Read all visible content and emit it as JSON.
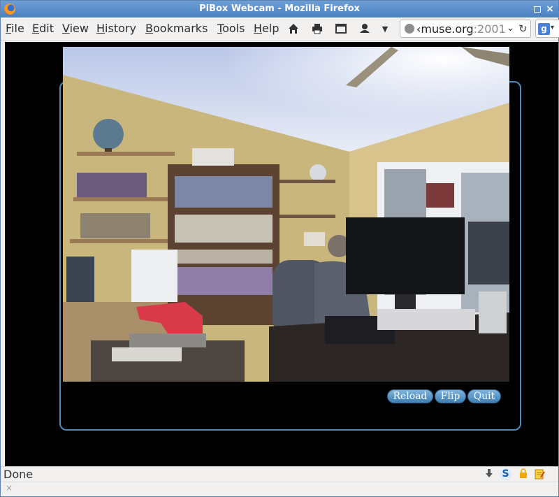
{
  "window": {
    "title": "PiBox Webcam - Mozilla Firefox"
  },
  "menubar": {
    "items": [
      {
        "label": "File",
        "accel": "F",
        "rest": "ile"
      },
      {
        "label": "Edit",
        "accel": "E",
        "rest": "dit"
      },
      {
        "label": "View",
        "accel": "V",
        "rest": "iew"
      },
      {
        "label": "History",
        "accel": "H",
        "rest": "istory"
      },
      {
        "label": "Bookmarks",
        "accel": "B",
        "rest": "ookmarks"
      },
      {
        "label": "Tools",
        "accel": "T",
        "rest": "ools"
      },
      {
        "label": "Help",
        "accel": "H",
        "rest": "elp"
      }
    ],
    "toolbar_icons": [
      "home-icon",
      "print-icon",
      "window-icon",
      "user-icon",
      "dropdown-icon"
    ]
  },
  "urlbar": {
    "host": "‹muse.org",
    "port": ":2001"
  },
  "search": {
    "engine_icon": "google-icon",
    "engine_letter": "g"
  },
  "webcam": {
    "buttons": {
      "reload": "Reload",
      "flip": "Flip",
      "quit": "Quit"
    },
    "accent": "#4a8bc0"
  },
  "statusbar": {
    "text": "Done",
    "icons": [
      "download-icon",
      "s-icon",
      "lock-icon",
      "notes-icon"
    ]
  },
  "addonbar": {
    "close": "×"
  }
}
